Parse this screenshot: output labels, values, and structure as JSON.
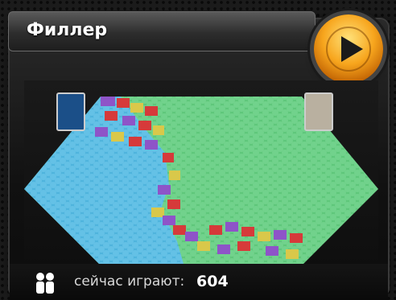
{
  "game": {
    "title": "Филлер",
    "online_label": "сейчас играют:",
    "online_count": "604"
  },
  "colors": {
    "player1_territory": "#4fb4dd",
    "player2_territory": "#5fc77b",
    "purple": "#8e54c8",
    "red": "#d63a3a",
    "yellow": "#d9c84a",
    "play_orange": "#f7a51d"
  },
  "icons": {
    "play": "play-icon",
    "people": "people-icon"
  }
}
